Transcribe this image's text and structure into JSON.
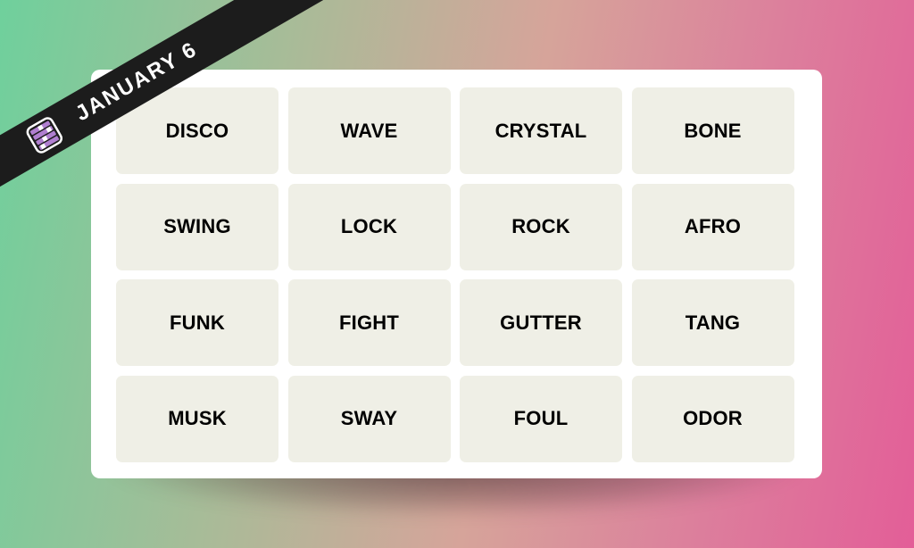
{
  "banner": {
    "date": "JANUARY 6",
    "icon": "connections-grid-icon"
  },
  "board": {
    "tiles": [
      "DISCO",
      "WAVE",
      "CRYSTAL",
      "BONE",
      "SWING",
      "LOCK",
      "ROCK",
      "AFRO",
      "FUNK",
      "FIGHT",
      "GUTTER",
      "TANG",
      "MUSK",
      "SWAY",
      "FOUL",
      "ODOR"
    ]
  },
  "colors": {
    "tile_background": "#efefe6",
    "banner_background": "#1c1c1c",
    "icon_purple": "#b07fd0"
  }
}
